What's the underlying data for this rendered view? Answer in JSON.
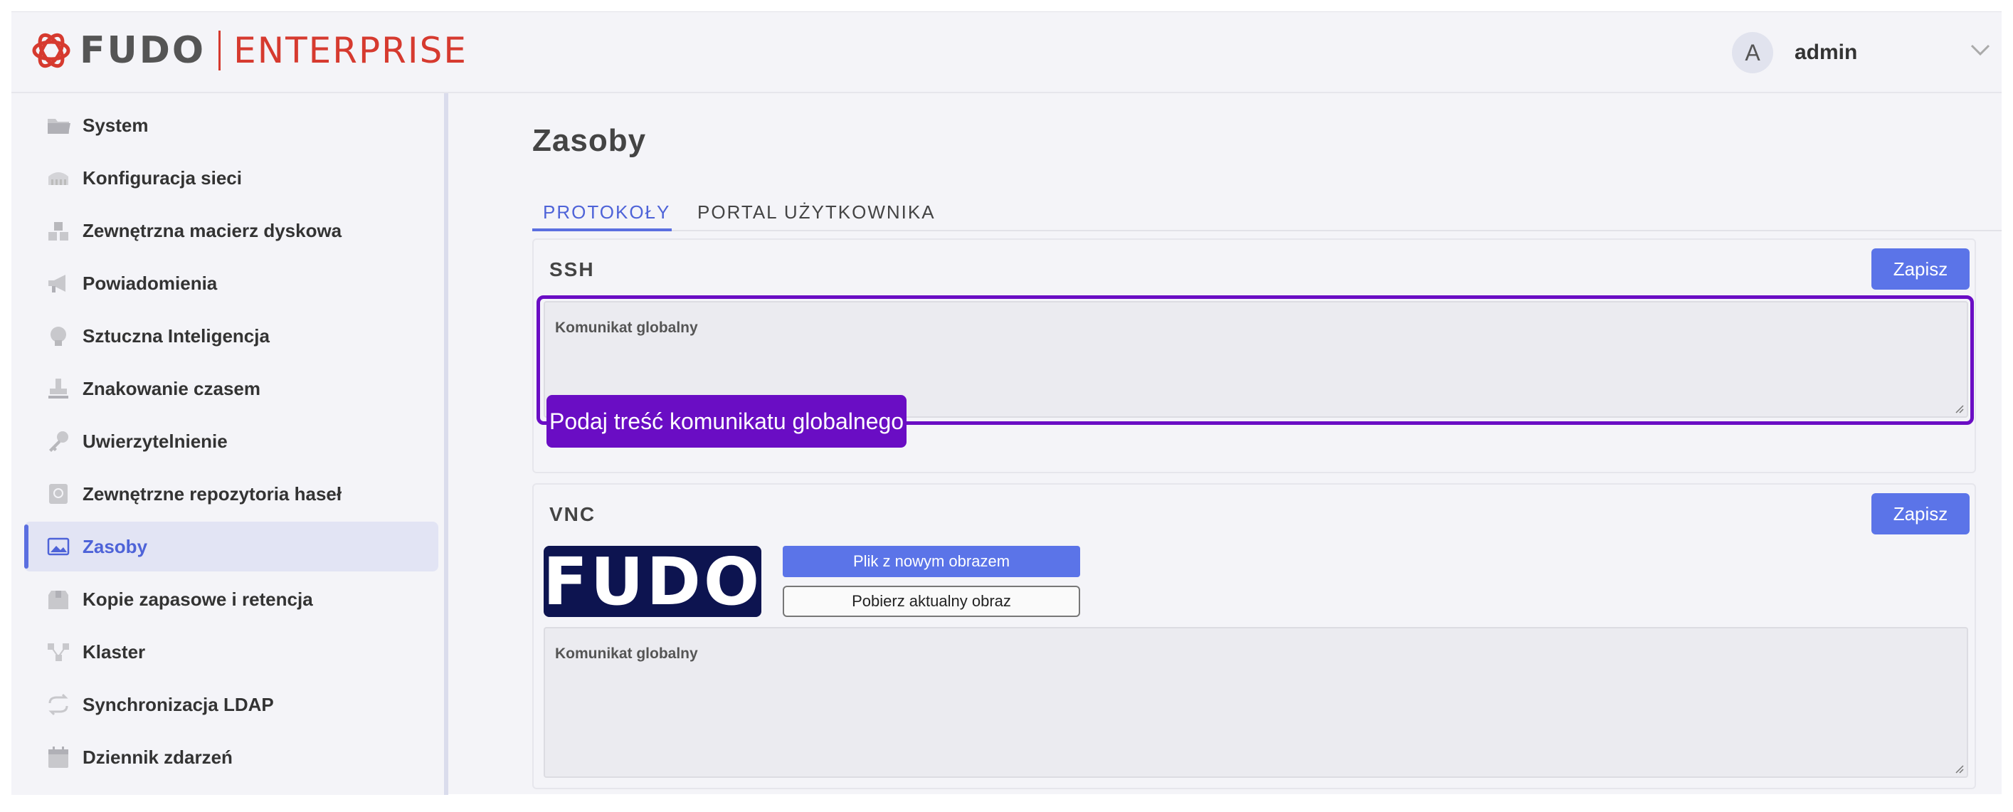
{
  "header": {
    "logo_fudo": "FUDO",
    "logo_enterprise": "ENTERPRISE",
    "user_initial": "A",
    "username": "admin"
  },
  "sidebar": {
    "items": [
      {
        "label": "System",
        "icon": "folder-icon"
      },
      {
        "label": "Konfiguracja sieci",
        "icon": "network-icon"
      },
      {
        "label": "Zewnętrzna macierz dyskowa",
        "icon": "disk-array-icon"
      },
      {
        "label": "Powiadomienia",
        "icon": "megaphone-icon"
      },
      {
        "label": "Sztuczna Inteligencja",
        "icon": "brain-icon"
      },
      {
        "label": "Znakowanie czasem",
        "icon": "stamp-icon"
      },
      {
        "label": "Uwierzytelnienie",
        "icon": "key-icon"
      },
      {
        "label": "Zewnętrzne repozytoria haseł",
        "icon": "vault-icon"
      },
      {
        "label": "Zasoby",
        "icon": "image-icon",
        "active": true
      },
      {
        "label": "Kopie zapasowe i retencja",
        "icon": "box-icon"
      },
      {
        "label": "Klaster",
        "icon": "cluster-icon"
      },
      {
        "label": "Synchronizacja LDAP",
        "icon": "sync-icon"
      },
      {
        "label": "Dziennik zdarzeń",
        "icon": "calendar-icon"
      }
    ]
  },
  "main": {
    "title": "Zasoby",
    "tabs": [
      {
        "label": "PROTOKOŁY",
        "active": true
      },
      {
        "label": "PORTAL UŻYTKOWNIKA",
        "active": false
      }
    ],
    "ssh": {
      "title": "SSH",
      "save_label": "Zapisz",
      "field_label": "Komunikat globalny",
      "placeholder": "Podaj treść komunikatu globalnego"
    },
    "vnc": {
      "title": "VNC",
      "save_label": "Zapisz",
      "logo_text": "FUDO",
      "file_button": "Plik z nowym obrazem",
      "download_button": "Pobierz aktualny obraz",
      "field_label": "Komunikat globalny"
    }
  },
  "colors": {
    "accent": "#5b74e8",
    "highlight": "#6a0dc4",
    "brand_red": "#d63a2f",
    "vnc_logo_bg": "#0d1450"
  }
}
